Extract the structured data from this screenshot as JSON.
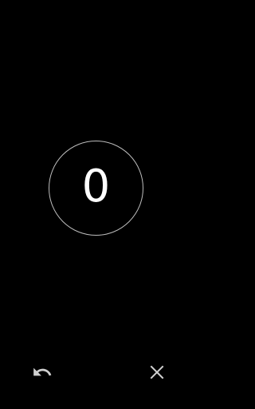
{
  "counter": {
    "value": "0"
  },
  "icons": {
    "undo": "undo-icon",
    "close": "close-icon"
  },
  "colors": {
    "background": "#000000",
    "counter_text": "#FFFFFF",
    "circle_border": "#BDBDBD",
    "icon": "#D0D0D0"
  }
}
